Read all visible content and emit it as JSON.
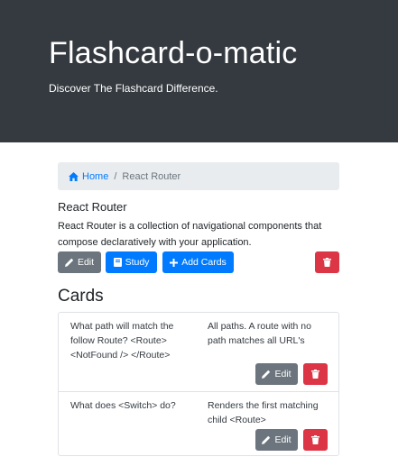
{
  "header": {
    "title": "Flashcard-o-matic",
    "subtitle": "Discover The Flashcard Difference."
  },
  "breadcrumb": {
    "home_label": "Home",
    "separator": "/",
    "current": "React Router"
  },
  "deck": {
    "name": "React Router",
    "description": "React Router is a collection of navigational components that compose declaratively with your application.",
    "edit_label": "Edit",
    "study_label": "Study",
    "add_cards_label": "Add Cards"
  },
  "cards_heading": "Cards",
  "cards": [
    {
      "front": "What path will match the follow Route? <Route> <NotFound /> </Route>",
      "back": "All paths. A route with no path matches all URL's",
      "edit_label": "Edit"
    },
    {
      "front": "What does <Switch> do?",
      "back": "Renders the first matching child <Route>",
      "edit_label": "Edit"
    }
  ],
  "colors": {
    "header_bg": "#343a40",
    "primary": "#007bff",
    "secondary": "#6c757d",
    "danger": "#dc3545"
  },
  "icons": {
    "home": "home-icon",
    "edit": "pencil-icon",
    "study": "book-icon",
    "add": "plus-icon",
    "delete": "trash-icon"
  }
}
